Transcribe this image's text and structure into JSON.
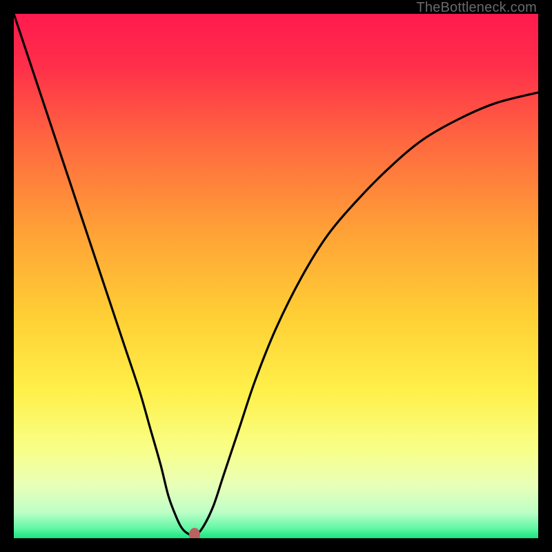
{
  "watermark": "TheBottleneck.com",
  "gradient_stops": [
    {
      "pct": 0,
      "color": "#ff1a4e"
    },
    {
      "pct": 10,
      "color": "#ff2f4a"
    },
    {
      "pct": 25,
      "color": "#ff6a3f"
    },
    {
      "pct": 42,
      "color": "#ffa336"
    },
    {
      "pct": 58,
      "color": "#ffd035"
    },
    {
      "pct": 72,
      "color": "#fff04a"
    },
    {
      "pct": 83,
      "color": "#f8ff88"
    },
    {
      "pct": 90,
      "color": "#e8ffb8"
    },
    {
      "pct": 95,
      "color": "#beffc7"
    },
    {
      "pct": 98,
      "color": "#66f7a6"
    },
    {
      "pct": 100,
      "color": "#17e67f"
    }
  ],
  "marker": {
    "x_frac": 0.345,
    "y_frac": 0.993
  },
  "chart_data": {
    "type": "line",
    "title": "",
    "xlabel": "",
    "ylabel": "",
    "xlim": [
      0,
      100
    ],
    "ylim": [
      0,
      100
    ],
    "series": [
      {
        "name": "bottleneck-curve",
        "x": [
          0,
          3,
          6,
          9,
          12,
          15,
          18,
          21,
          24,
          26,
          28,
          29.5,
          31,
          32,
          33,
          34.5,
          36,
          38,
          40,
          43,
          46,
          50,
          55,
          60,
          66,
          72,
          78,
          85,
          92,
          100
        ],
        "y": [
          100,
          91,
          82,
          73,
          64,
          55,
          46,
          37,
          28,
          21,
          14,
          8,
          4,
          2,
          1,
          0.5,
          2,
          6,
          12,
          21,
          30,
          40,
          50,
          58,
          65,
          71,
          76,
          80,
          83,
          85
        ]
      }
    ],
    "marker_point": {
      "x": 34.5,
      "y": 0.5
    },
    "annotations": [
      {
        "text": "TheBottleneck.com",
        "role": "watermark",
        "position": "top-right"
      }
    ]
  }
}
